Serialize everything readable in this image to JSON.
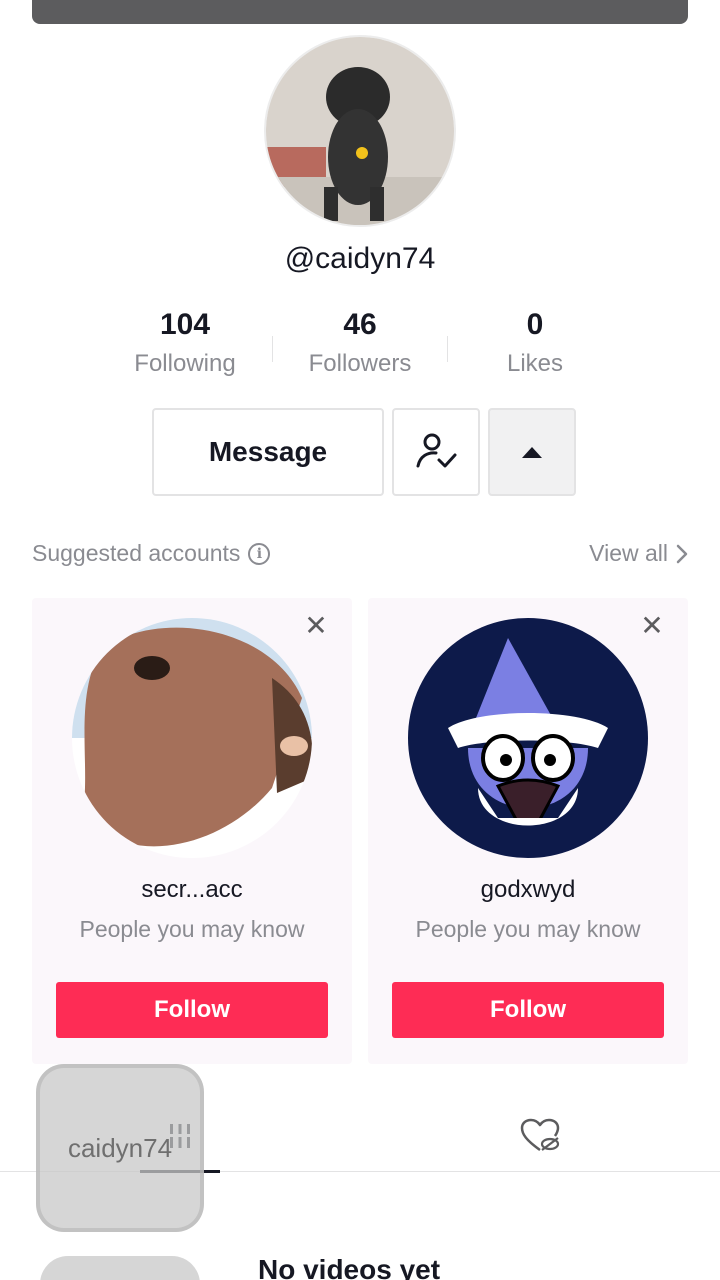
{
  "profile": {
    "username": "@caidyn74",
    "stats": [
      {
        "value": "104",
        "label": "Following"
      },
      {
        "value": "46",
        "label": "Followers"
      },
      {
        "value": "0",
        "label": "Likes"
      }
    ]
  },
  "actions": {
    "message_label": "Message"
  },
  "suggested": {
    "title": "Suggested accounts",
    "view_all": "View all",
    "accounts": [
      {
        "name": "secr...acc",
        "reason": "People you may know",
        "follow_label": "Follow"
      },
      {
        "name": "godxwyd",
        "reason": "People you may know",
        "follow_label": "Follow"
      }
    ]
  },
  "watermark": "caidyn74",
  "empty_state": "No videos yet",
  "colors": {
    "accent": "#fe2c55",
    "text": "#161823",
    "muted": "#8a8b91"
  }
}
